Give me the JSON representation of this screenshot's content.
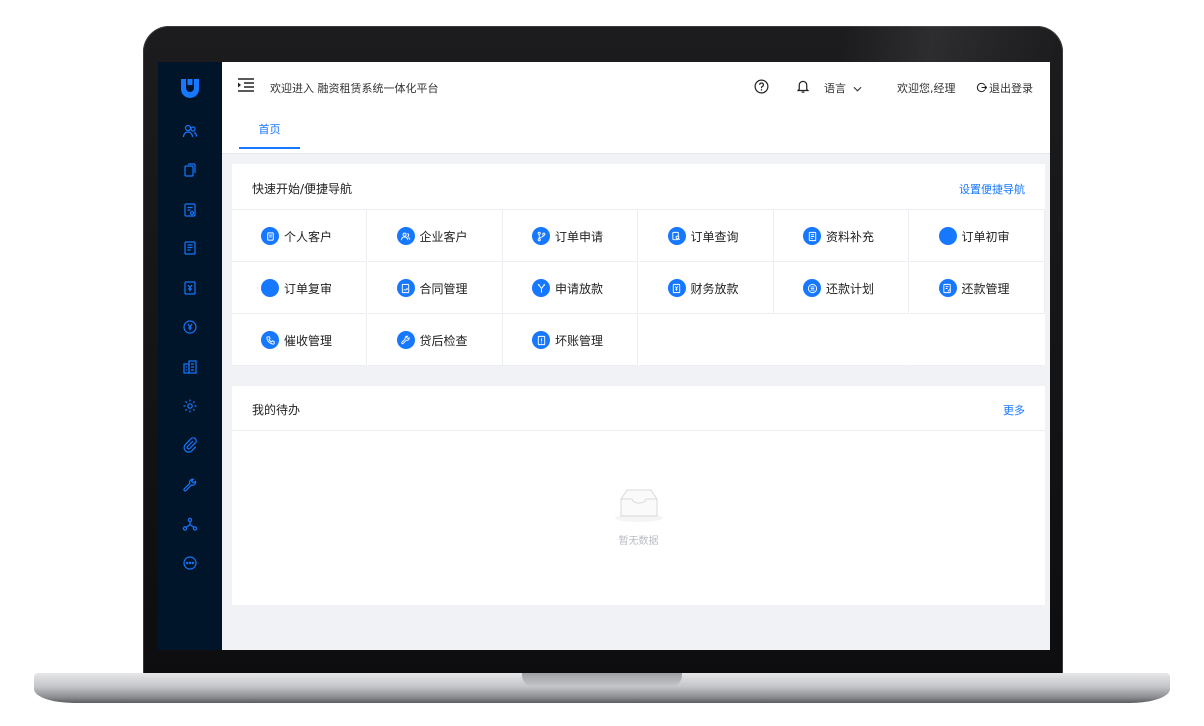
{
  "header": {
    "welcome_title": "欢迎进入 融资租赁系统一体化平台",
    "language_label": "语言",
    "user_greeting": "欢迎您,经理",
    "logout_label": "退出登录"
  },
  "tabs": [
    {
      "label": "首页"
    }
  ],
  "quick_nav": {
    "title": "快速开始/便捷导航",
    "settings_link": "设置便捷导航",
    "items": [
      {
        "label": "个人客户",
        "icon": "document-icon"
      },
      {
        "label": "企业客户",
        "icon": "users-icon"
      },
      {
        "label": "订单申请",
        "icon": "branch-icon"
      },
      {
        "label": "订单查询",
        "icon": "search-doc-icon"
      },
      {
        "label": "资料补充",
        "icon": "doc-add-icon"
      },
      {
        "label": "订单初审",
        "icon": "blank-circle-icon"
      },
      {
        "label": "订单复审",
        "icon": "blank-circle-icon"
      },
      {
        "label": "合同管理",
        "icon": "contract-icon"
      },
      {
        "label": "申请放款",
        "icon": "split-icon"
      },
      {
        "label": "财务放款",
        "icon": "money-doc-icon"
      },
      {
        "label": "还款计划",
        "icon": "list-icon"
      },
      {
        "label": "还款管理",
        "icon": "edit-doc-icon"
      },
      {
        "label": "催收管理",
        "icon": "phone-icon"
      },
      {
        "label": "贷后检查",
        "icon": "wrench-icon"
      },
      {
        "label": "坏账管理",
        "icon": "doc-alert-icon"
      }
    ]
  },
  "todo": {
    "title": "我的待办",
    "more_link": "更多",
    "empty_text": "暂无数据"
  },
  "sidebar": {
    "items": [
      {
        "icon": "users-icon"
      },
      {
        "icon": "copy-icon"
      },
      {
        "icon": "doc-check-icon"
      },
      {
        "icon": "doc-list-icon"
      },
      {
        "icon": "doc-money-icon"
      },
      {
        "icon": "yen-icon"
      },
      {
        "icon": "building-icon"
      },
      {
        "icon": "gear-icon"
      },
      {
        "icon": "paperclip-icon"
      },
      {
        "icon": "wrench-icon"
      },
      {
        "icon": "network-icon"
      },
      {
        "icon": "more-icon"
      }
    ]
  },
  "colors": {
    "sidebar_bg": "#001529",
    "accent": "#1677ff",
    "page_bg": "#f0f2f5"
  }
}
